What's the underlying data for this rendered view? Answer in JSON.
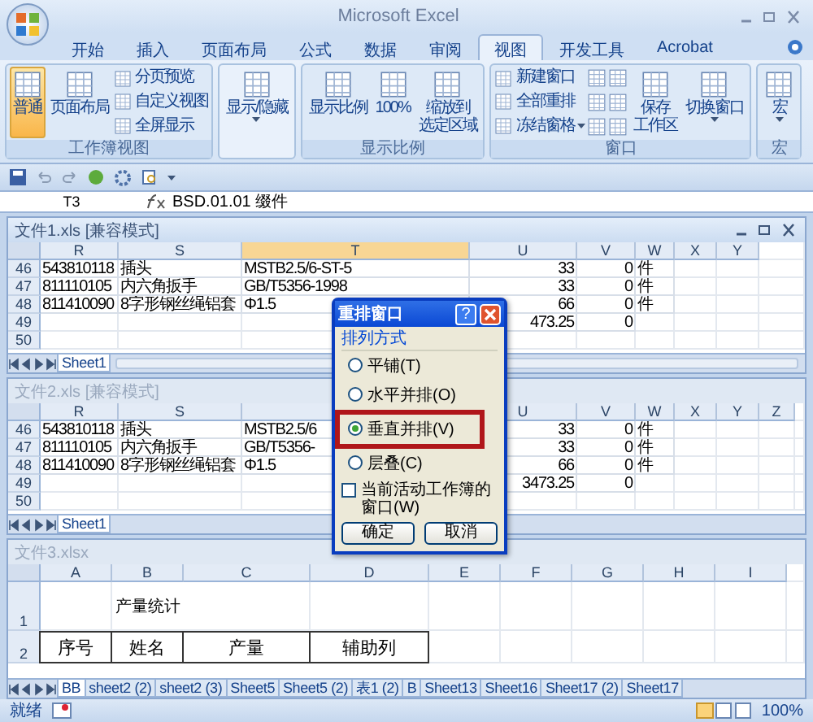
{
  "window": {
    "title": "Microsoft Excel"
  },
  "tabs": [
    {
      "label": "开始",
      "selected": false
    },
    {
      "label": "插入",
      "selected": false
    },
    {
      "label": "页面布局",
      "selected": false
    },
    {
      "label": "公式",
      "selected": false
    },
    {
      "label": "数据",
      "selected": false
    },
    {
      "label": "审阅",
      "selected": false
    },
    {
      "label": "视图",
      "selected": true
    },
    {
      "label": "开发工具",
      "selected": false
    },
    {
      "label": "Acrobat",
      "selected": false
    }
  ],
  "ribbon": {
    "groups": [
      {
        "label": "工作簿视图",
        "items": [
          {
            "kind": "large",
            "lines": [
              "普通"
            ],
            "selected": true,
            "dropdown": false
          },
          {
            "kind": "large",
            "lines": [
              "页面布局"
            ],
            "selected": false,
            "dropdown": false
          },
          {
            "kind": "stack",
            "entries": [
              {
                "label": "分页预览",
                "dropdown": false
              },
              {
                "label": "自定义视图",
                "dropdown": false
              },
              {
                "label": "全屏显示",
                "dropdown": false
              }
            ]
          }
        ]
      },
      {
        "items": [
          {
            "kind": "large",
            "lines": [
              "显示/隐藏"
            ],
            "selected": false,
            "dropdown": true
          }
        ]
      },
      {
        "label": "显示比例",
        "items": [
          {
            "kind": "large",
            "lines": [
              "显示比例"
            ],
            "selected": false,
            "dropdown": false
          },
          {
            "kind": "large",
            "lines": [
              "100%"
            ],
            "selected": false,
            "dropdown": false
          },
          {
            "kind": "large",
            "lines": [
              "缩放到",
              "选定区域"
            ],
            "selected": false,
            "dropdown": false
          }
        ]
      },
      {
        "label": "窗口",
        "items": [
          {
            "kind": "stack",
            "entries": [
              {
                "label": "新建窗口",
                "dropdown": false
              },
              {
                "label": "全部重排",
                "dropdown": false
              },
              {
                "label": "冻结窗格",
                "dropdown": true
              }
            ]
          },
          {
            "kind": "icon_stack"
          },
          {
            "kind": "icon_stack"
          },
          {
            "kind": "large",
            "lines": [
              "保存",
              "工作区"
            ],
            "selected": false,
            "dropdown": false
          },
          {
            "kind": "large",
            "lines": [
              "切换窗口"
            ],
            "selected": false,
            "dropdown": true
          }
        ]
      },
      {
        "label": "宏",
        "items": [
          {
            "kind": "large",
            "lines": [
              "宏"
            ],
            "selected": false,
            "dropdown": true
          }
        ]
      }
    ]
  },
  "formula_bar": {
    "name_box": "T3",
    "formula": "BSD.01.01 缀件"
  },
  "workbooks": [
    {
      "title": "文件1.xls  [兼容模式]",
      "active": true,
      "columns": [
        {
          "label": "R",
          "numeric": false,
          "selected": false
        },
        {
          "label": "S",
          "numeric": false,
          "selected": false
        },
        {
          "label": "T",
          "numeric": false,
          "selected": true
        },
        {
          "label": "U",
          "numeric": true,
          "selected": false
        },
        {
          "label": "V",
          "numeric": true,
          "selected": false
        },
        {
          "label": "W",
          "numeric": false,
          "selected": false
        },
        {
          "label": "X",
          "selected": false
        },
        {
          "label": "Y",
          "selected": false
        }
      ],
      "rows": [
        {
          "kind": "data",
          "number": "46",
          "cells": [
            "543810118",
            "插头",
            "MSTB2.5/6-ST-5",
            "33",
            "0",
            "件"
          ]
        },
        {
          "kind": "data",
          "number": "47",
          "cells": [
            "811110105",
            "内六角扳手",
            "GB/T5356-1998",
            "33",
            "0",
            "件"
          ]
        },
        {
          "kind": "data",
          "number": "48",
          "cells": [
            "811410090",
            "8字形钢丝绳铝套",
            "Φ1.5",
            "66",
            "0",
            "件"
          ]
        },
        {
          "kind": "data",
          "number": "49",
          "cells": [
            null,
            null,
            null,
            "473.25",
            "0",
            null
          ]
        },
        {
          "kind": "data",
          "number": "50",
          "cells": []
        }
      ],
      "sheet_tabs": [
        {
          "label": "Sheet1",
          "selected": true
        }
      ]
    },
    {
      "title": "文件2.xls  [兼容模式]",
      "active": false,
      "columns": [
        {
          "label": "R",
          "numeric": false,
          "selected": false
        },
        {
          "label": "S",
          "numeric": false,
          "selected": false
        },
        {
          "numeric": false,
          "selected": false
        },
        {
          "label": "U",
          "numeric": true,
          "selected": false
        },
        {
          "label": "V",
          "numeric": true,
          "selected": false
        },
        {
          "label": "W",
          "numeric": false,
          "selected": false
        },
        {
          "label": "X",
          "selected": false
        },
        {
          "label": "Y",
          "selected": false
        },
        {
          "label": "Z",
          "selected": false
        }
      ],
      "rows": [
        {
          "kind": "data",
          "number": "46",
          "cells": [
            "543810118",
            "插头",
            "MSTB2.5/6",
            "33",
            "0",
            "件"
          ]
        },
        {
          "kind": "data",
          "number": "47",
          "cells": [
            "811110105",
            "内六角扳手",
            "GB/T5356-",
            "33",
            "0",
            "件"
          ]
        },
        {
          "kind": "data",
          "number": "48",
          "cells": [
            "811410090",
            "8字形钢丝绳铝套",
            "Φ1.5",
            "66",
            "0",
            "件"
          ]
        },
        {
          "kind": "data",
          "number": "49",
          "cells": [
            null,
            null,
            null,
            "3473.25",
            "0",
            null
          ]
        },
        {
          "kind": "data",
          "number": "50",
          "cells": []
        }
      ],
      "sheet_tabs": [
        {
          "label": "Sheet1",
          "selected": true
        }
      ]
    },
    {
      "title": "文件3.xlsx",
      "active": false,
      "columns": [
        {
          "label": "A",
          "selected": false
        },
        {
          "label": "B",
          "selected": false
        },
        {
          "label": "C",
          "selected": false
        },
        {
          "label": "D",
          "selected": false
        },
        {
          "label": "E",
          "selected": false
        },
        {
          "label": "F",
          "selected": false
        },
        {
          "label": "G",
          "selected": false
        },
        {
          "label": "H",
          "selected": false
        },
        {
          "label": "I",
          "selected": false
        }
      ],
      "rows": [
        {
          "kind": "title",
          "number": "1",
          "cells": [
            null,
            "产量统计"
          ]
        },
        {
          "kind": "boxed",
          "number": "2",
          "cells": [
            "序号",
            "姓名",
            "产量",
            "辅助列"
          ]
        }
      ],
      "sheet_tabs": [
        {
          "label": "BB",
          "selected": true
        },
        {
          "label": "sheet2 (2)",
          "selected": false
        },
        {
          "label": "sheet2 (3)",
          "selected": false
        },
        {
          "label": "Sheet5",
          "selected": false
        },
        {
          "label": "Sheet5 (2)",
          "selected": false
        },
        {
          "label": "表1 (2)",
          "selected": false
        },
        {
          "label": "B",
          "selected": false
        },
        {
          "label": "Sheet13",
          "selected": false
        },
        {
          "label": "Sheet16",
          "selected": false
        },
        {
          "label": "Sheet17 (2)",
          "selected": false
        },
        {
          "label": "Sheet17",
          "selected": false
        }
      ]
    }
  ],
  "dialog": {
    "title": "重排窗口",
    "help": "?",
    "group": "排列方式",
    "options": [
      {
        "label": "平铺(T)",
        "selected": false,
        "highlighted": false
      },
      {
        "label": "水平并排(O)",
        "selected": false,
        "highlighted": false
      },
      {
        "label": "垂直并排(V)",
        "selected": true,
        "highlighted": true
      },
      {
        "label": "层叠(C)",
        "selected": false,
        "highlighted": false
      }
    ],
    "checkbox": {
      "label": "当前活动工作簿的窗口(W)",
      "checked": false
    },
    "buttons": [
      "确定",
      "取消"
    ]
  },
  "status_bar": {
    "status": "就绪",
    "zoom": "100%"
  }
}
